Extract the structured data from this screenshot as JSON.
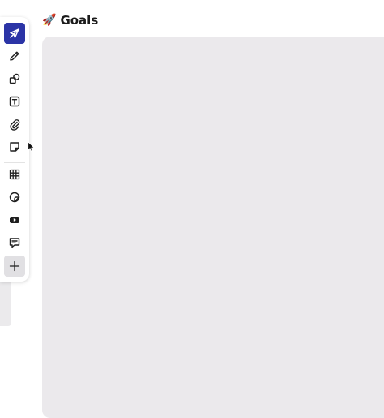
{
  "board": {
    "title": "Goals",
    "title_emoji": "🚀"
  },
  "toolbar": {
    "active_tool": "select",
    "accent_color": "#2b34a6",
    "tools": [
      {
        "name": "select",
        "icon": "arrow-pointer-icon"
      },
      {
        "name": "pen",
        "icon": "pencil-icon"
      },
      {
        "name": "shapes",
        "icon": "shapes-icon"
      },
      {
        "name": "text",
        "icon": "text-icon"
      },
      {
        "name": "attachment",
        "icon": "paperclip-icon"
      },
      {
        "name": "sticky-note",
        "icon": "sticky-note-icon"
      },
      {
        "name": "table",
        "icon": "table-icon"
      },
      {
        "name": "sticker",
        "icon": "sticker-icon"
      },
      {
        "name": "video",
        "icon": "video-icon"
      },
      {
        "name": "comment",
        "icon": "comment-icon"
      },
      {
        "name": "more",
        "icon": "plus-icon"
      }
    ]
  }
}
